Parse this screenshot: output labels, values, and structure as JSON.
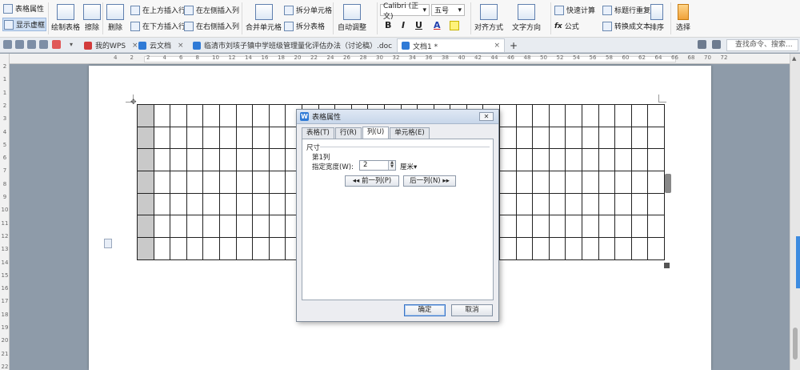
{
  "ribbon": {
    "table_props": "表格属性",
    "show_gridlines": "显示虚框",
    "draw_table": "绘制表格",
    "erase": "擦除",
    "delete": "删除",
    "insert_above": "在上方插入行",
    "insert_below": "在下方插入行",
    "insert_left": "在左侧插入列",
    "insert_right": "在右侧插入列",
    "merge_cells": "合并单元格",
    "split_cells": "拆分单元格",
    "split_table": "拆分表格",
    "autofit": "自动调整",
    "font_name": "Calibri (正文)",
    "font_size": "五号",
    "bold": "B",
    "italic": "I",
    "underline": "U",
    "font_color": "A",
    "align": "对齐方式",
    "text_direction": "文字方向",
    "quick_calc": "快速计算",
    "formula": "公式",
    "repeat_header": "标题行重复",
    "convert_to_text": "转换成文本",
    "sort": "排序",
    "select": "选择"
  },
  "tabs": {
    "my_wps": "我的WPS",
    "cloud_docs": "云文档",
    "doc1_name": "临清市刘垓子镇中学班级管理量化评估办法（讨论稿）.doc",
    "doc2_name": "文档1 *",
    "close_glyph": "×",
    "new_tab": "+",
    "search_placeholder": "查找命令、搜索..."
  },
  "ruler": {
    "h_numbers": [
      "4",
      "2",
      "2",
      "4",
      "6",
      "8",
      "10",
      "12",
      "14",
      "16",
      "18",
      "20",
      "22",
      "24",
      "26",
      "28",
      "30",
      "32",
      "34",
      "36",
      "38",
      "40",
      "42",
      "44",
      "46",
      "48",
      "50",
      "52",
      "54",
      "56",
      "58",
      "60",
      "62",
      "64",
      "66",
      "68",
      "70",
      "72"
    ],
    "v_numbers": [
      "2",
      "1",
      "1",
      "2",
      "3",
      "4",
      "5",
      "6",
      "7",
      "8",
      "9",
      "10",
      "11",
      "12",
      "13",
      "14",
      "15",
      "16",
      "17",
      "18",
      "19",
      "20",
      "21",
      "22"
    ]
  },
  "table": {
    "rows": 7,
    "cols": 32
  },
  "dialog": {
    "title": "表格属性",
    "close": "✕",
    "tabs": [
      "表格(T)",
      "行(R)",
      "列(U)",
      "单元格(E)"
    ],
    "section_label": "尺寸",
    "column_label": "第1列",
    "width_label": "指定宽度(W):",
    "width_value": "2",
    "unit": "厘米▾",
    "prev_col": "◂◂ 前一列(P)",
    "next_col": "后一列(N) ▸▸",
    "ok": "确定",
    "cancel": "取消"
  },
  "colors": {
    "accent": "#2f7ad6",
    "ribbon_bg": "#f7f7f7",
    "workspace": "#8e9ba9",
    "shade_col": "#c9c9c9"
  }
}
